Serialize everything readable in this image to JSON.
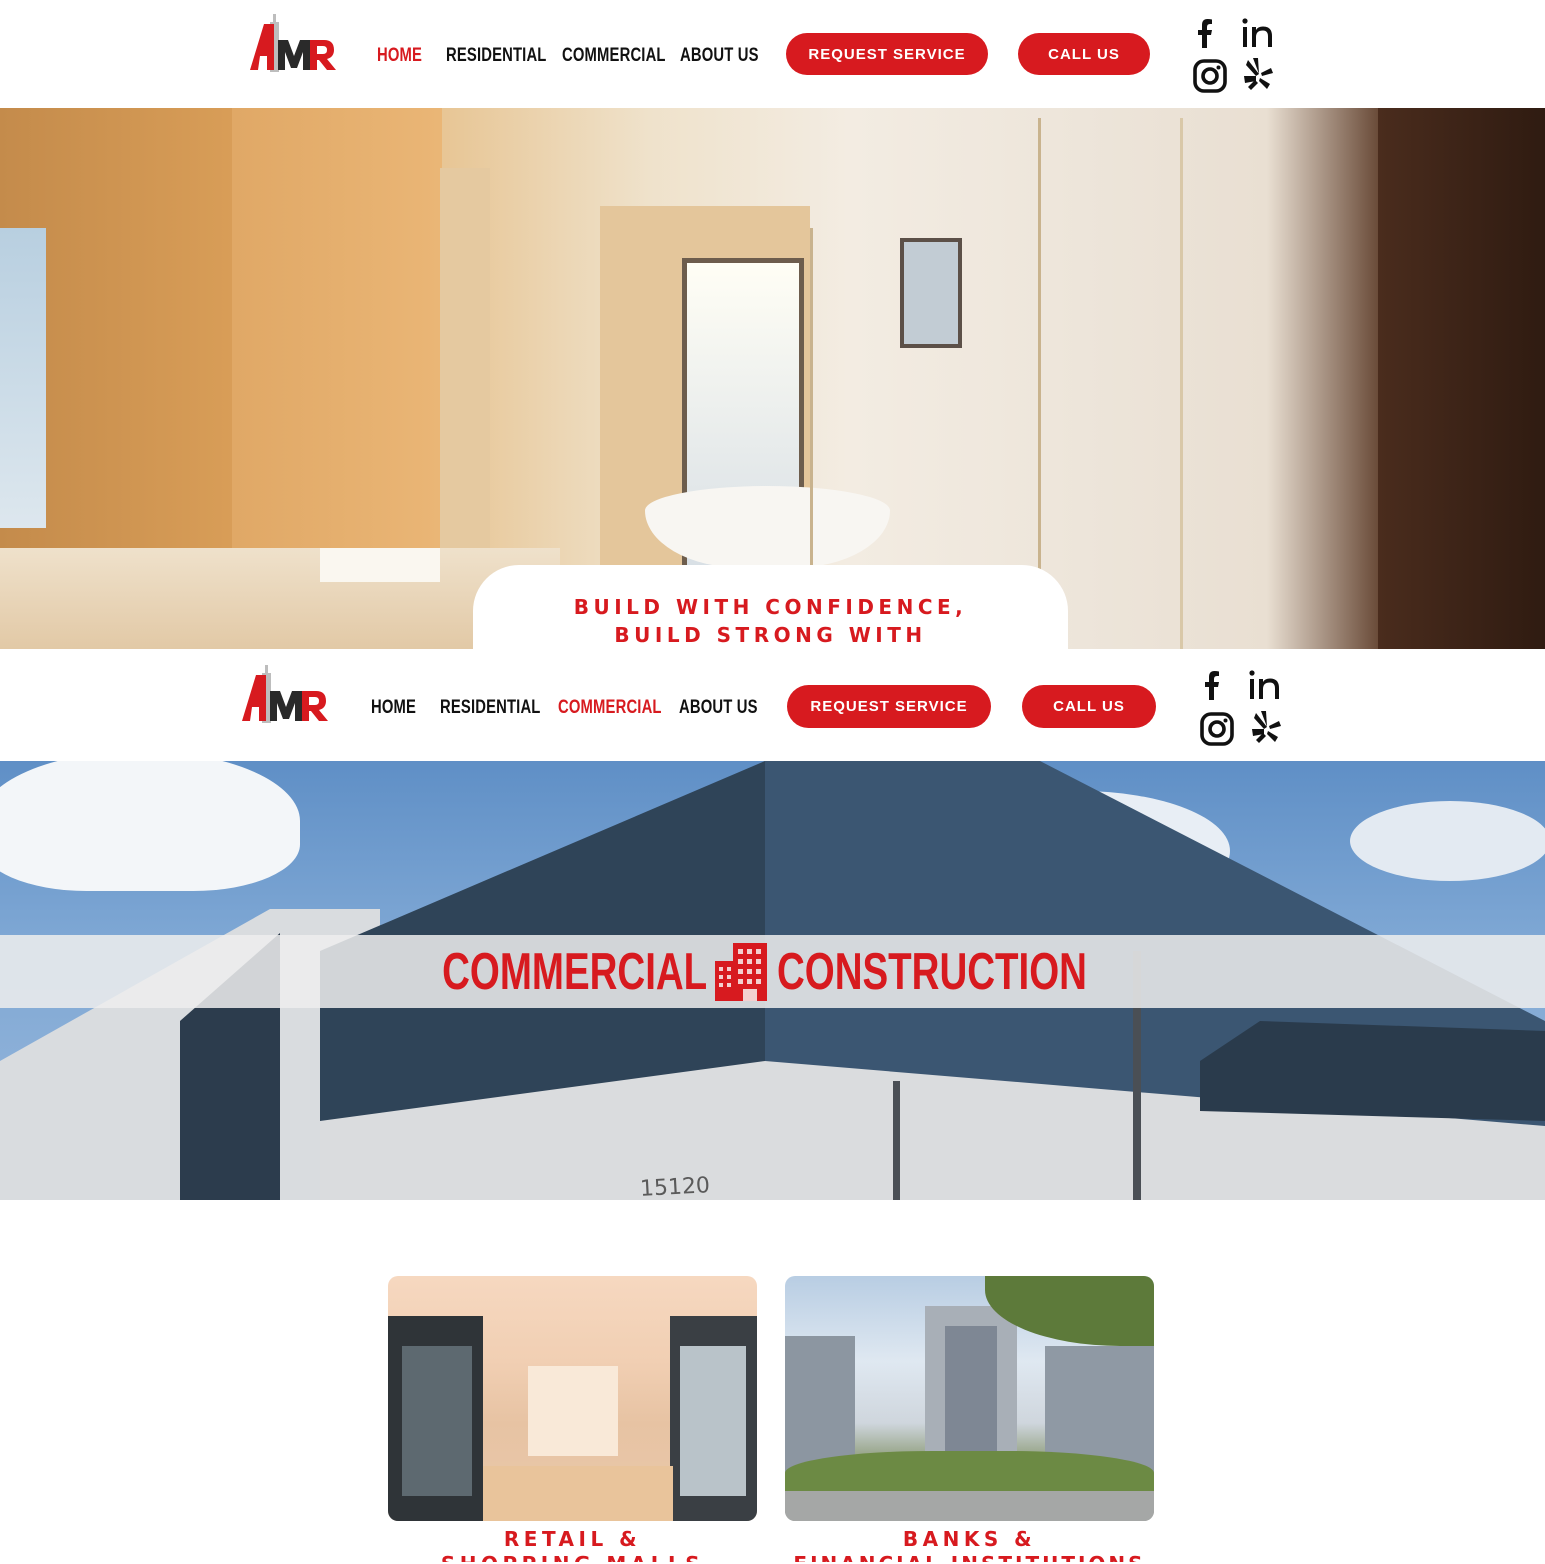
{
  "header_top": {
    "logo_text": "AMR",
    "nav": [
      {
        "label": "HOME",
        "active": true
      },
      {
        "label": "RESIDENTIAL",
        "active": false
      },
      {
        "label": "COMMERCIAL",
        "active": false
      },
      {
        "label": "ABOUT US",
        "active": false
      }
    ],
    "request_service": "REQUEST SERVICE",
    "call_us": "CALL US"
  },
  "hero_residential": {
    "tagline_line1": "BUILD WITH CONFIDENCE,",
    "tagline_line2": "BUILD STRONG WITH"
  },
  "header_commercial": {
    "logo_text": "AMR",
    "nav": [
      {
        "label": "HOME",
        "active": false
      },
      {
        "label": "RESIDENTIAL",
        "active": false
      },
      {
        "label": "COMMERCIAL",
        "active": true
      },
      {
        "label": "ABOUT US",
        "active": false
      }
    ],
    "request_service": "REQUEST SERVICE",
    "call_us": "CALL US"
  },
  "hero_commercial": {
    "banner_left": "COMMERCIAL",
    "banner_right": "CONSTRUCTION",
    "building_number": "15120"
  },
  "cards": [
    {
      "title_line1": "RETAIL &",
      "title_line2": "SHOPPING MALLS"
    },
    {
      "title_line1": "BANKS &",
      "title_line2": "FINANCIAL INSTITUTIONS"
    }
  ],
  "social_icons": [
    "facebook-icon",
    "linkedin-icon",
    "instagram-icon",
    "yelp-icon"
  ],
  "colors": {
    "accent": "#d71a1f",
    "text": "#111111",
    "background": "#ffffff"
  }
}
